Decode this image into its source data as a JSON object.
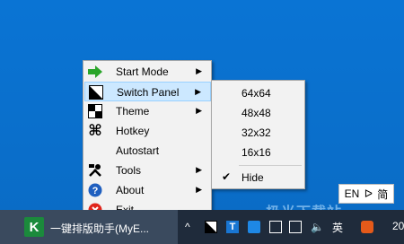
{
  "menu": {
    "items": [
      {
        "label": "Start Mode",
        "icon": "green-arrow-icon",
        "submenu": true
      },
      {
        "label": "Switch Panel",
        "icon": "switch-panel-icon",
        "submenu": true,
        "highlighted": true
      },
      {
        "label": "Theme",
        "icon": "checkerboard-icon",
        "submenu": true
      },
      {
        "label": "Hotkey",
        "icon": "command-key-icon",
        "submenu": false
      },
      {
        "label": "Autostart",
        "icon": "",
        "submenu": false
      },
      {
        "label": "Tools",
        "icon": "tools-icon",
        "submenu": true
      },
      {
        "label": "About",
        "icon": "help-icon",
        "submenu": true
      },
      {
        "label": "Exit",
        "icon": "exit-icon",
        "submenu": false
      }
    ]
  },
  "submenu": {
    "items": [
      {
        "label": "64x64",
        "checked": false
      },
      {
        "label": "48x48",
        "checked": false
      },
      {
        "label": "32x32",
        "checked": false
      },
      {
        "label": "16x16",
        "checked": false
      },
      {
        "label": "Hide",
        "checked": true
      }
    ]
  },
  "ime": {
    "lang": "EN",
    "mode": "ᐅ",
    "char": "简"
  },
  "watermark": "极光下载站",
  "taskbar": {
    "app_label": "一键排版助手(MyE...",
    "tray_chevron": "^",
    "ime_indicator": "英",
    "clock_fragment": "20"
  },
  "colors": {
    "desktop": "#0a6fc9",
    "menu_bg": "#f2f2f2",
    "highlight": "#cce8ff",
    "taskbar": "#1f2b3b"
  }
}
